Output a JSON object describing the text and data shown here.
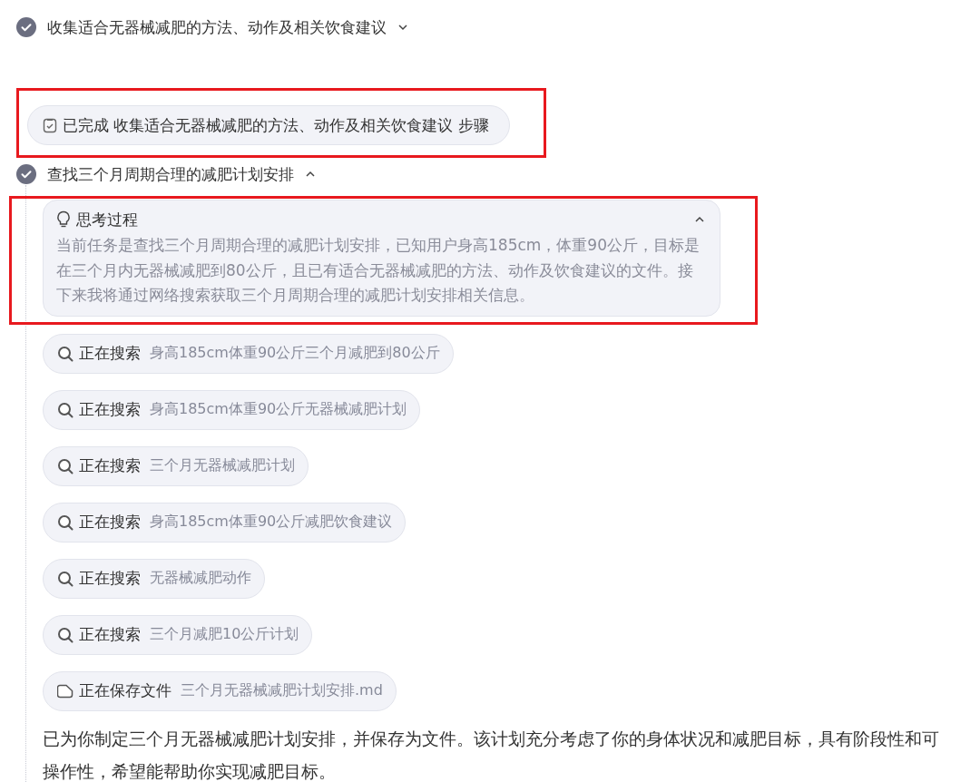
{
  "timeline": [
    {
      "kind": "step",
      "title": "收集适合无器械减肥的方法、动作及相关饮食建议",
      "expanded": false
    },
    {
      "kind": "notice",
      "label": "已完成",
      "text": "收集适合无器械减肥的方法、动作及相关饮食建议",
      "suffix": "步骤",
      "highlighted": true
    },
    {
      "kind": "step",
      "title": "查找三个月周期合理的减肥计划安排",
      "expanded": true
    }
  ],
  "thinking": {
    "title": "思考过程",
    "expanded": true,
    "highlighted": true,
    "text": "当前任务是查找三个月周期合理的减肥计划安排，已知用户身高185cm，体重90公斤，目标是在三个月内无器械减肥到80公斤，且已有适合无器械减肥的方法、动作及饮食建议的文件。接下来我将通过网络搜索获取三个月周期合理的减肥计划安排相关信息。"
  },
  "actions": [
    {
      "kind": "search",
      "label": "正在搜索",
      "query": "身高185cm体重90公斤三个月减肥到80公斤"
    },
    {
      "kind": "search",
      "label": "正在搜索",
      "query": "身高185cm体重90公斤无器械减肥计划"
    },
    {
      "kind": "search",
      "label": "正在搜索",
      "query": "三个月无器械减肥计划"
    },
    {
      "kind": "search",
      "label": "正在搜索",
      "query": "身高185cm体重90公斤减肥饮食建议"
    },
    {
      "kind": "search",
      "label": "正在搜索",
      "query": "无器械减肥动作"
    },
    {
      "kind": "search",
      "label": "正在搜索",
      "query": "三个月减肥10公斤计划"
    },
    {
      "kind": "save",
      "label": "正在保存文件",
      "query": "三个月无器械减肥计划安排.md"
    }
  ],
  "result": "已为你制定三个月无器械减肥计划安排，并保存为文件。该计划充分考虑了你的身体状况和减肥目标，具有阶段性和可操作性，希望能帮助你实现减肥目标。"
}
